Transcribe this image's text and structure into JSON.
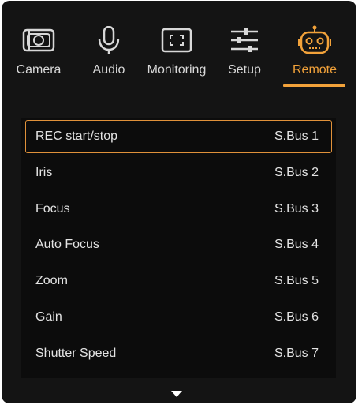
{
  "tabs": [
    {
      "label": "Camera",
      "icon": "camera-icon",
      "active": false
    },
    {
      "label": "Audio",
      "icon": "microphone-icon",
      "active": false
    },
    {
      "label": "Monitoring",
      "icon": "monitoring-frame-icon",
      "active": false
    },
    {
      "label": "Setup",
      "icon": "sliders-icon",
      "active": false
    },
    {
      "label": "Remote",
      "icon": "remote-robot-icon",
      "active": true
    }
  ],
  "colors": {
    "accent": "#f2a23a",
    "background": "#141414",
    "text": "#e4e4e4"
  },
  "rows": [
    {
      "label": "REC start/stop",
      "value": "S.Bus 1",
      "selected": true
    },
    {
      "label": "Iris",
      "value": "S.Bus 2",
      "selected": false
    },
    {
      "label": "Focus",
      "value": "S.Bus 3",
      "selected": false
    },
    {
      "label": "Auto Focus",
      "value": "S.Bus 4",
      "selected": false
    },
    {
      "label": "Zoom",
      "value": "S.Bus 5",
      "selected": false
    },
    {
      "label": "Gain",
      "value": "S.Bus 6",
      "selected": false
    },
    {
      "label": "Shutter Speed",
      "value": "S.Bus 7",
      "selected": false
    }
  ],
  "scroll_indicator": "down-arrow-icon"
}
